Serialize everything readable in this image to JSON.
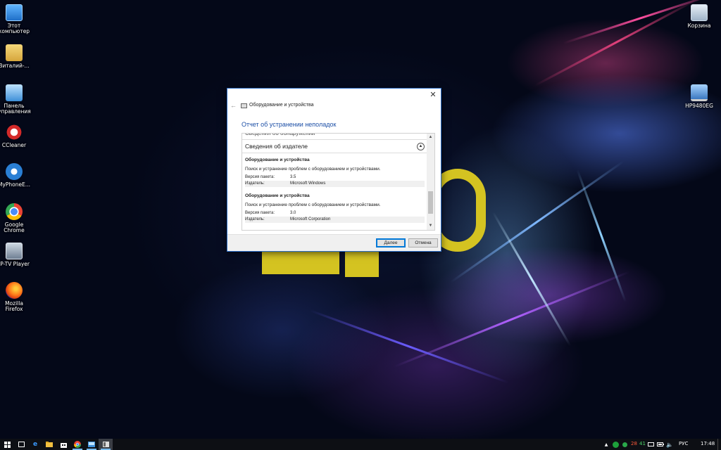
{
  "desktop": {
    "icons_left": [
      {
        "label": "Этот компьютер",
        "icon": "computer-icon"
      },
      {
        "label": "Виталий-...",
        "icon": "user-folder-icon"
      },
      {
        "label": "Панель управления",
        "icon": "control-panel-icon"
      },
      {
        "label": "CCleaner",
        "icon": "ccleaner-icon"
      },
      {
        "label": "MyPhoneE...",
        "icon": "myphoneexplorer-icon"
      },
      {
        "label": "Google Chrome",
        "icon": "chrome-icon"
      },
      {
        "label": "IP-TV Player",
        "icon": "iptv-player-icon"
      },
      {
        "label": "Mozilla Firefox",
        "icon": "firefox-icon"
      }
    ],
    "icons_right": [
      {
        "label": "Корзина",
        "icon": "recycle-bin-icon"
      },
      {
        "label": "HP9480EG",
        "icon": "laptop-icon"
      }
    ]
  },
  "dialog": {
    "window_title": "Оборудование и устройства",
    "heading": "Отчет об устранении неполадок",
    "cut_off_section": "Сведения об обнаружении",
    "section_title": "Сведения об издателе",
    "entries": [
      {
        "title": "Оборудование и устройства",
        "description": "Поиск и устранение проблем с оборудованием и устройствами.",
        "version_label": "Версия пакета:",
        "version_value": "3.5",
        "publisher_label": "Издатель:",
        "publisher_value": "Microsoft Windows"
      },
      {
        "title": "Оборудование и устройства",
        "description": "Поиск и устранение проблем с оборудованием и устройствами.",
        "version_label": "Версия пакета:",
        "version_value": "3.0",
        "publisher_label": "Издатель:",
        "publisher_value": "Microsoft Corporation"
      }
    ],
    "next_button": "Далее",
    "cancel_button": "Отмена"
  },
  "taskbar": {
    "apps": [
      "start-icon",
      "task-view-icon",
      "edge-icon",
      "explorer-icon",
      "store-icon",
      "chrome-icon",
      "control-panel-icon",
      "troubleshooter-icon"
    ],
    "tray": {
      "temp1": "28",
      "temp2": "41",
      "language": "РУС",
      "time": "17:48"
    }
  },
  "colors": {
    "accent": "#0078d7",
    "heading_blue": "#1c4fa6",
    "win10_yellow": "#d4c321"
  }
}
